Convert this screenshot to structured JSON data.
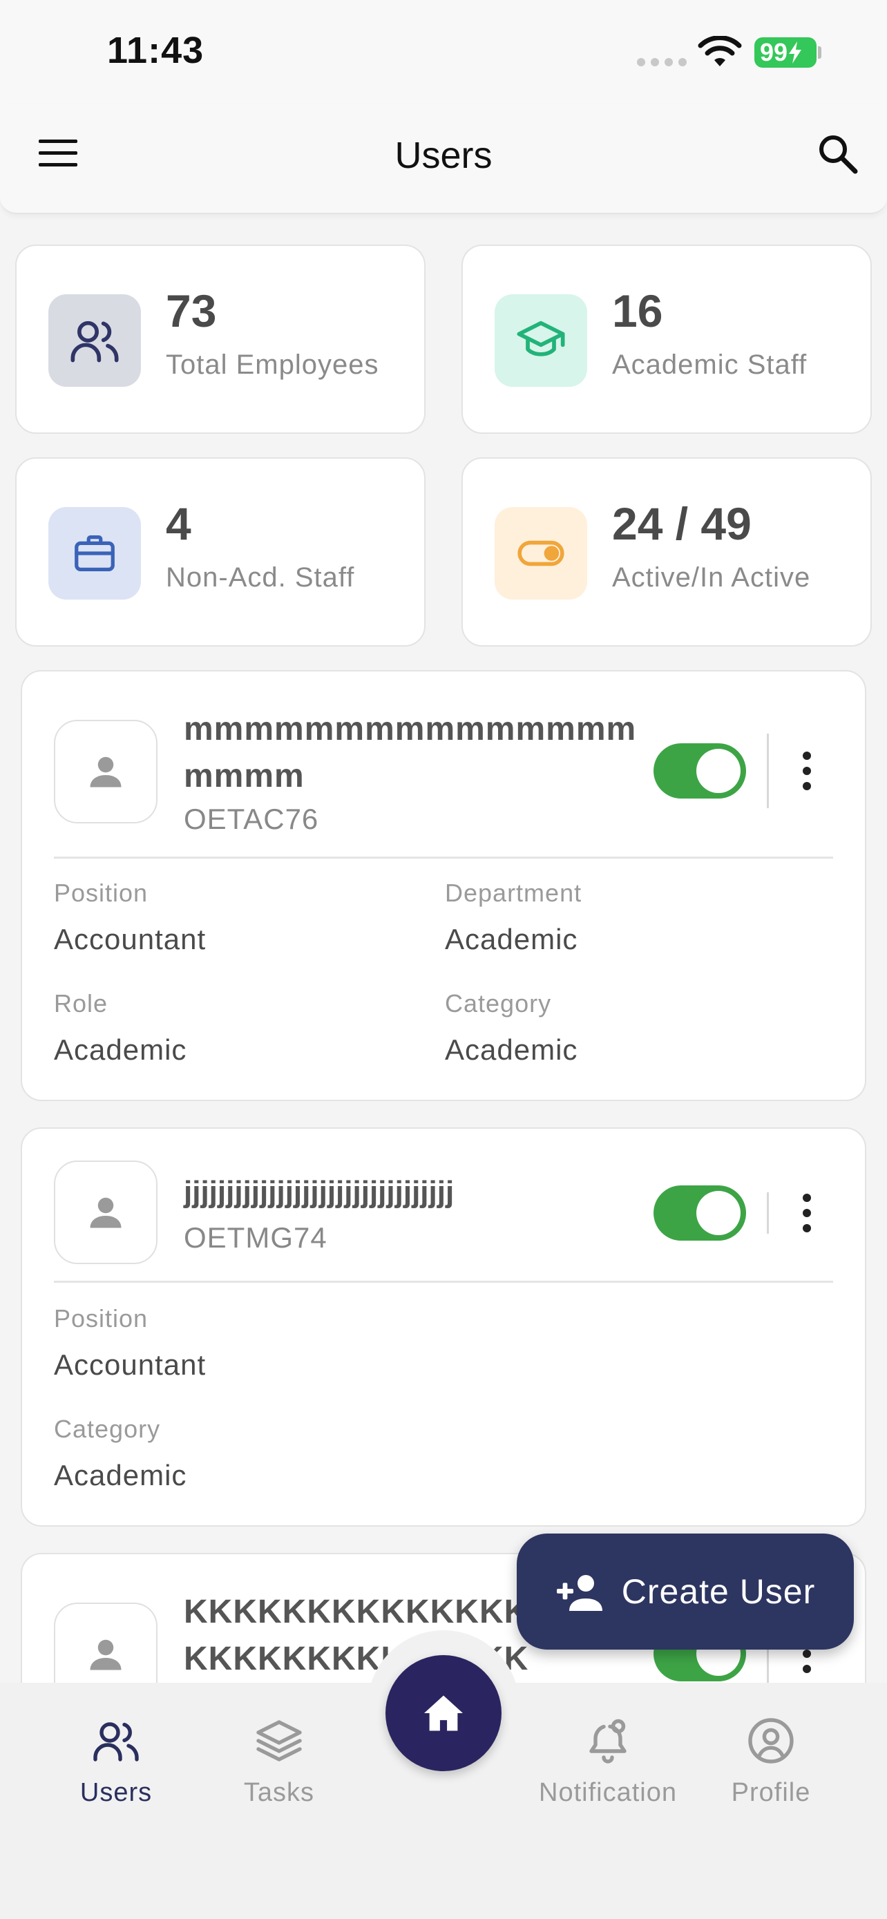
{
  "status_bar": {
    "time": "11:43",
    "battery": "99"
  },
  "app_bar": {
    "title": "Users"
  },
  "stats": [
    {
      "value": "73",
      "label": "Total Employees",
      "icon": "users-icon",
      "bg": "#d9dbe3",
      "fg": "#2f3566"
    },
    {
      "value": "16",
      "label": "Academic Staff",
      "icon": "graduation-cap-icon",
      "bg": "#d7f5ea",
      "fg": "#22b37a"
    },
    {
      "value": "4",
      "label": "Non-Acd. Staff",
      "icon": "briefcase-icon",
      "bg": "#dce3f4",
      "fg": "#3a63b8"
    },
    {
      "value": "24 / 49",
      "label": "Active/In Active",
      "icon": "toggle-icon",
      "bg": "#fff0dc",
      "fg": "#f0a63a"
    }
  ],
  "users": [
    {
      "name": "mmmmmmmmmmmmmmmmmmm",
      "code": "OETAC76",
      "active": true,
      "fields": [
        {
          "label": "Position",
          "value": "Accountant"
        },
        {
          "label": "Department",
          "value": "Academic"
        },
        {
          "label": "Role",
          "value": "Academic"
        },
        {
          "label": "Category",
          "value": "Academic"
        }
      ]
    },
    {
      "name": "jjjjjjjjjjjjjjjjjjjjjjjjjjjjjjjj",
      "code": "OETMG74",
      "active": true,
      "fields": [
        {
          "label": "Position",
          "value": "Accountant"
        },
        {
          "label": "Category",
          "value": "Academic"
        }
      ]
    },
    {
      "name": "KKKKKKKKKKKKKKKKKKKKKKKKKKKKK",
      "active": true
    }
  ],
  "fab": {
    "label": "Create User"
  },
  "nav": [
    {
      "label": "Users",
      "active": true
    },
    {
      "label": "Tasks",
      "active": false
    },
    {
      "label": "Notification",
      "active": false
    },
    {
      "label": "Profile",
      "active": false
    }
  ],
  "colors": {
    "primary": "#2d3561",
    "toggle_on": "#3da446"
  }
}
